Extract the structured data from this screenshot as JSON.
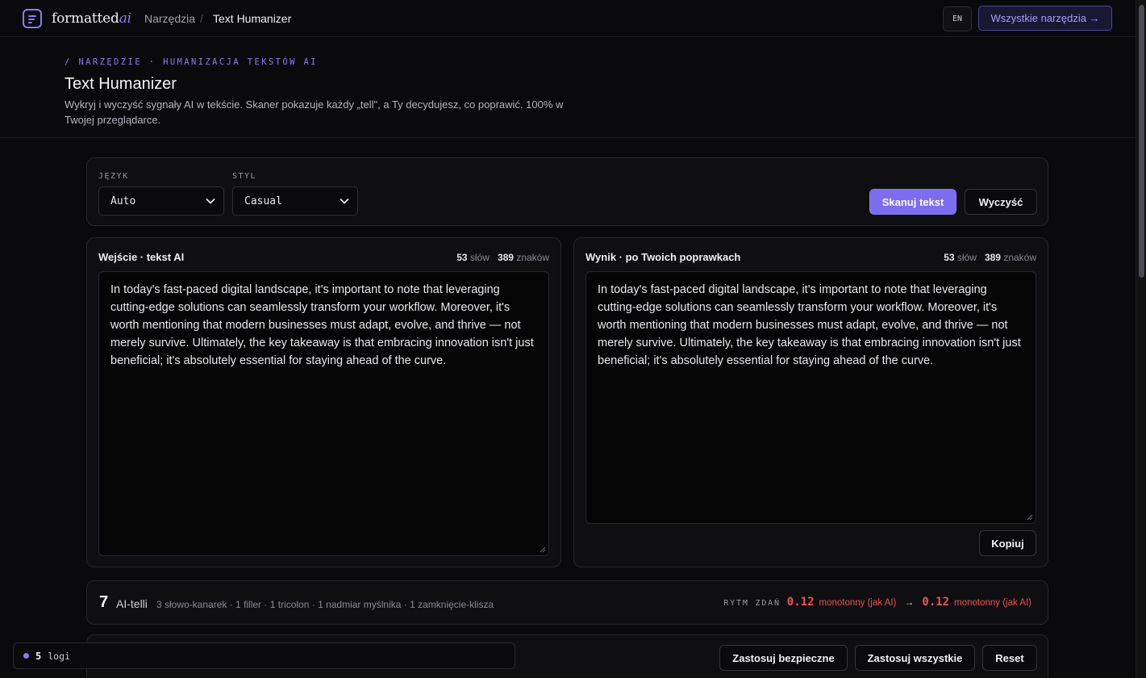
{
  "brand": {
    "name_main": "formatted",
    "name_accent": "ai"
  },
  "nav": {
    "breadcrumb_root": "Narzędzia",
    "separator": "/",
    "breadcrumb_current": "Text Humanizer"
  },
  "header_actions": {
    "lang": "EN",
    "all_tools": "Wszystkie narzędzia →"
  },
  "hero": {
    "eyebrow": "/ NARZĘDZIE · HUMANIZACJA TEKSTÓW AI",
    "title": "Text Humanizer",
    "description": "Wykryj i wyczyść sygnały AI w tekście. Skaner pokazuje każdy „tell\", a Ty decydujesz, co poprawić. 100% w Twojej przeglądarce."
  },
  "controls": {
    "language_label": "JĘZYK",
    "language_value": "Auto",
    "style_label": "STYL",
    "style_value": "Casual",
    "scan_button": "Skanuj tekst",
    "clear_button": "Wyczyść"
  },
  "input_panel": {
    "title": "Wejście · tekst AI",
    "word_count": "53",
    "word_unit": "słów",
    "char_count": "389",
    "char_unit": "znaków",
    "text": "In today's fast-paced digital landscape, it's important to note that leveraging cutting-edge solutions can seamlessly transform your workflow. Moreover, it's worth mentioning that modern businesses must adapt, evolve, and thrive — not merely survive. Ultimately, the key takeaway is that embracing innovation isn't just beneficial; it's absolutely essential for staying ahead of the curve."
  },
  "output_panel": {
    "title": "Wynik · po Twoich poprawkach",
    "word_count": "53",
    "word_unit": "słów",
    "char_count": "389",
    "char_unit": "znaków",
    "text": "In today's fast-paced digital landscape, it's important to note that leveraging cutting-edge solutions can seamlessly transform your workflow. Moreover, it's worth mentioning that modern businesses must adapt, evolve, and thrive — not merely survive. Ultimately, the key takeaway is that embracing innovation isn't just beneficial; it's absolutely essential for staying ahead of the curve.",
    "copy_button": "Kopiuj"
  },
  "summary": {
    "count": "7",
    "label": "AI-telli",
    "details": "3 słowo-kanarek · 1 filler · 1 tricolon · 1 nadmiar myślnika · 1 zamknięcie-klisza",
    "rhythm_label": "RYTM ZDAŃ",
    "rhythm_before": "0.12",
    "rhythm_before_desc": "monotonny (jak AI)",
    "arrow": "→",
    "rhythm_after": "0.12",
    "rhythm_after_desc": "monotonny (jak AI)"
  },
  "actions": {
    "apply_safe": "Zastosuj bezpieczne",
    "apply_all": "Zastosuj wszystkie",
    "reset": "Reset"
  },
  "logs": {
    "count": "5",
    "label": "logi"
  },
  "colors": {
    "accent": "#8b7cf6",
    "primary_button": "#7c6cf0",
    "warning": "#ef5350",
    "background": "#0a0a0c"
  }
}
